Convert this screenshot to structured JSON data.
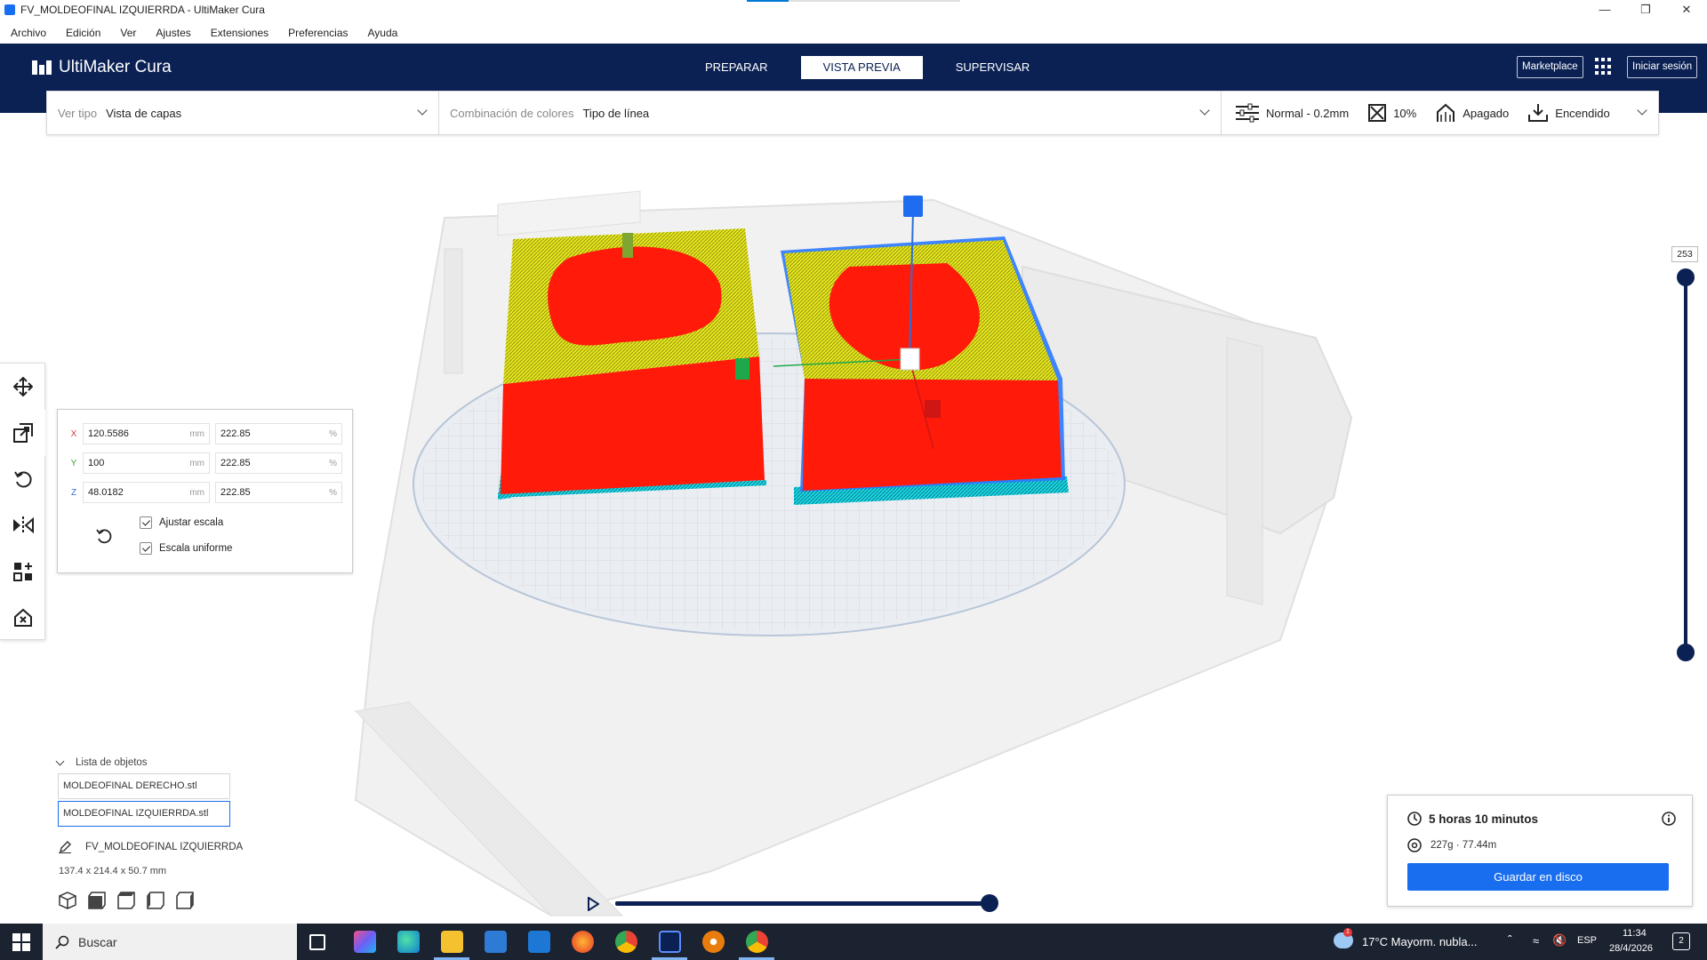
{
  "window": {
    "title": "FV_MOLDEOFINAL IZQUIERRDA - UltiMaker Cura",
    "controls": [
      "minimize-icon",
      "restore-icon",
      "close-icon"
    ]
  },
  "menu": [
    "Archivo",
    "Edición",
    "Ver",
    "Ajustes",
    "Extensiones",
    "Preferencias",
    "Ayuda"
  ],
  "header": {
    "logo": "UltiMaker Cura",
    "tabs": [
      {
        "label": "PREPARAR",
        "active": false
      },
      {
        "label": "VISTA PREVIA",
        "active": true
      },
      {
        "label": "SUPERVISAR",
        "active": false
      }
    ],
    "marketplace": "Marketplace",
    "signin": "Iniciar sesión"
  },
  "viewbar": {
    "view_type_label": "Ver tipo",
    "view_type_value": "Vista de capas",
    "color_scheme_label": "Combinación de colores",
    "color_scheme_value": "Tipo de línea",
    "profile": "Normal - 0.2mm",
    "infill": "10%",
    "support": "Apagado",
    "adhesion": "Encendido"
  },
  "scale_tool": {
    "x": {
      "mm": "120.5586",
      "pct": "222.85",
      "axis": "X"
    },
    "y": {
      "mm": "100",
      "pct": "222.85",
      "axis": "Y"
    },
    "z": {
      "mm": "48.0182",
      "pct": "222.85",
      "axis": "Z"
    },
    "unit_mm": "mm",
    "unit_pct": "%",
    "snap_scaling": "Ajustar escala",
    "uniform_scaling": "Escala uniforme",
    "axis_colors": {
      "x": "#d03b3b",
      "y": "#3aa63a",
      "z": "#2c6fd6"
    }
  },
  "layer_slider": {
    "top_layer": "253",
    "max_fraction": 1.0,
    "min_fraction": 0.0
  },
  "object_list": {
    "title": "Lista de objetos",
    "items": [
      "MOLDEOFINAL DERECHO.stl",
      "MOLDEOFINAL IZQUIERRDA.stl"
    ],
    "selected_index": 1,
    "job_name": "FV_MOLDEOFINAL IZQUIERRDA",
    "dimensions": "137.4 x 214.4 x 50.7 mm"
  },
  "simulation": {
    "progress": 1.0
  },
  "print_info": {
    "time": "5 horas 10 minutos",
    "material": "227g · 77.44m",
    "save_button": "Guardar en disco"
  },
  "taskbar": {
    "search_placeholder": "Buscar",
    "weather": "17°C  Mayorm. nubla...",
    "language": "ESP",
    "time": "11:34",
    "date": "28/4/2026",
    "notif_count": "2",
    "weather_badge": "1"
  },
  "colors": {
    "header_bg": "#0b2154",
    "accent": "#196ef0",
    "wall_red": "#ff1a0a",
    "infill_yellow": "#e8e41a",
    "skirt_cyan": "#19d7e6"
  }
}
